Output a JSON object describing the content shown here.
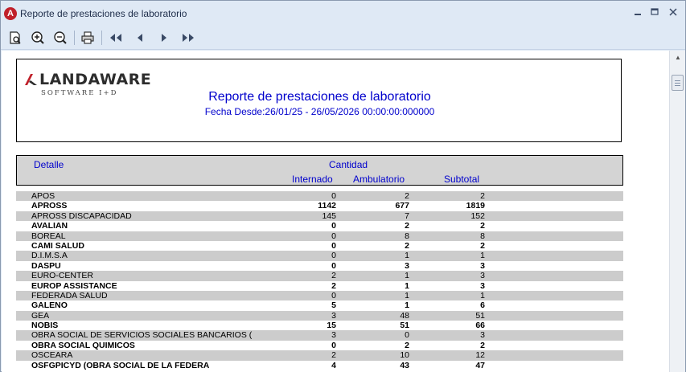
{
  "window": {
    "title": "Reporte de prestaciones de laboratorio",
    "app_icon": "landaware-app-icon",
    "controls": [
      "minimize",
      "maximize",
      "close"
    ]
  },
  "toolbar": {
    "buttons": [
      "page-setup-icon",
      "zoom-in-icon",
      "zoom-out-icon",
      "print-icon",
      "first-page-icon",
      "previous-page-icon",
      "next-page-icon",
      "last-page-icon"
    ]
  },
  "report": {
    "logo_name": "LANDAWARE",
    "logo_sub": "SOFTWARE I+D",
    "title": "Reporte de prestaciones de laboratorio",
    "date_range": "Fecha Desde:26/01/25 - 26/05/2026 00:00:00:000000",
    "columns": {
      "detalle": "Detalle",
      "cantidad": "Cantidad",
      "internado": "Internado",
      "ambulatorio": "Ambulatorio",
      "subtotal": "Subtotal"
    },
    "rows": [
      {
        "name": "APOS",
        "internado": "0",
        "ambulatorio": "2",
        "subtotal": "2"
      },
      {
        "name": "APROSS",
        "internado": "1142",
        "ambulatorio": "677",
        "subtotal": "1819"
      },
      {
        "name": "APROSS DISCAPACIDAD",
        "internado": "145",
        "ambulatorio": "7",
        "subtotal": "152"
      },
      {
        "name": "AVALIAN",
        "internado": "0",
        "ambulatorio": "2",
        "subtotal": "2"
      },
      {
        "name": "BOREAL",
        "internado": "0",
        "ambulatorio": "8",
        "subtotal": "8"
      },
      {
        "name": "CAMI SALUD",
        "internado": "0",
        "ambulatorio": "2",
        "subtotal": "2"
      },
      {
        "name": "D.I.M.S.A",
        "internado": "0",
        "ambulatorio": "1",
        "subtotal": "1"
      },
      {
        "name": "DASPU",
        "internado": "0",
        "ambulatorio": "3",
        "subtotal": "3"
      },
      {
        "name": "EURO-CENTER",
        "internado": "2",
        "ambulatorio": "1",
        "subtotal": "3"
      },
      {
        "name": "EUROP ASSISTANCE",
        "internado": "2",
        "ambulatorio": "1",
        "subtotal": "3"
      },
      {
        "name": "FEDERADA SALUD",
        "internado": "0",
        "ambulatorio": "1",
        "subtotal": "1"
      },
      {
        "name": "GALENO",
        "internado": "5",
        "ambulatorio": "1",
        "subtotal": "6"
      },
      {
        "name": "GEA",
        "internado": "3",
        "ambulatorio": "48",
        "subtotal": "51"
      },
      {
        "name": "NOBIS",
        "internado": "15",
        "ambulatorio": "51",
        "subtotal": "66"
      },
      {
        "name": "OBRA SOCIAL DE SERVICIOS SOCIALES BANCARIOS (",
        "internado": "3",
        "ambulatorio": "0",
        "subtotal": "3"
      },
      {
        "name": "OBRA SOCIAL QUIMICOS",
        "internado": "0",
        "ambulatorio": "2",
        "subtotal": "2"
      },
      {
        "name": "OSCEARA",
        "internado": "2",
        "ambulatorio": "10",
        "subtotal": "12"
      },
      {
        "name": "OSFGPICYD (OBRA SOCIAL DE LA FEDERA",
        "internado": "4",
        "ambulatorio": "43",
        "subtotal": "47"
      }
    ]
  },
  "colors": {
    "accent": "#0000cc",
    "row_shade": "#cccccc",
    "chrome": "#dfe9f5"
  }
}
